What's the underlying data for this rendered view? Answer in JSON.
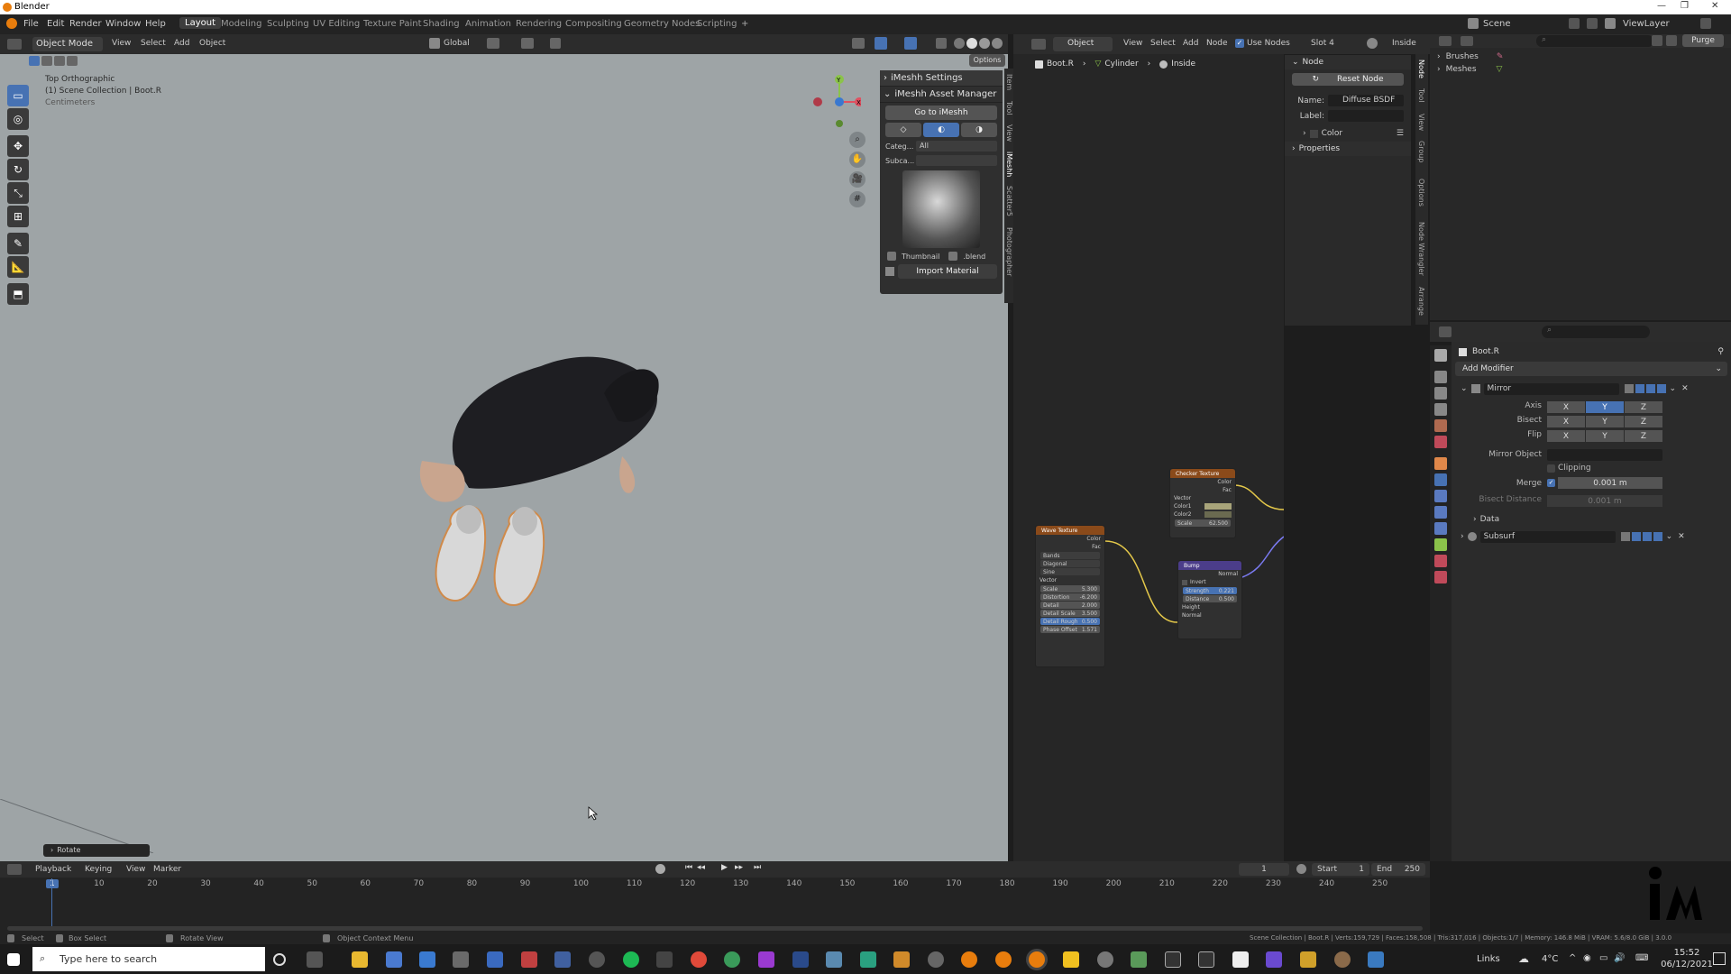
{
  "titlebar": {
    "title": "Blender"
  },
  "menu": [
    "File",
    "Edit",
    "Render",
    "Window",
    "Help"
  ],
  "workspaces": [
    "Layout",
    "Modeling",
    "Sculpting",
    "UV Editing",
    "Texture Paint",
    "Shading",
    "Animation",
    "Rendering",
    "Compositing",
    "Geometry Nodes",
    "Scripting"
  ],
  "scene": {
    "label": "Scene",
    "viewlayer": "ViewLayer",
    "purge": "Purge"
  },
  "viewport_header": {
    "mode": "Object Mode",
    "menus": [
      "View",
      "Select",
      "Add",
      "Object"
    ],
    "orientation": "Global",
    "options": "Options"
  },
  "viewport_info": {
    "line1": "Top Orthographic",
    "line2": "(1) Scene Collection | Boot.R",
    "line3": "Centimeters"
  },
  "npanel": {
    "settings": "iMeshh Settings",
    "asset_manager": "iMeshh Asset Manager",
    "goto": "Go to iMeshh",
    "category_label": "Categ...",
    "category_value": "All",
    "subcategory_label": "Subca...",
    "thumbnail": "Thumbnail",
    "blend": ".blend",
    "import": "Import Material"
  },
  "npanel_tabs": [
    "Item",
    "Tool",
    "View",
    "iMeshh",
    "Scatter5",
    "Photographer"
  ],
  "last_op": "Rotate",
  "node_header": {
    "object": "Object",
    "menus": [
      "View",
      "Select",
      "Add",
      "Node"
    ],
    "use_nodes": "Use Nodes",
    "slot": "Slot 4",
    "inside": "Inside"
  },
  "node_breadcrumb": [
    "Boot.R",
    "Cylinder",
    "Inside"
  ],
  "node_panel": {
    "title": "Node",
    "reset": "Reset Node",
    "name_label": "Name:",
    "name_value": "Diffuse BSDF",
    "label_label": "Label:",
    "color": "Color",
    "properties": "Properties"
  },
  "node_tabs": [
    "Node",
    "Tool",
    "View",
    "Group",
    "Options",
    "Node Wrangler",
    "Arrange"
  ],
  "nodes": {
    "checker": {
      "title": "Checker Texture",
      "outputs": [
        "Color",
        "Fac"
      ],
      "inputs": [
        "Vector",
        "Color1",
        "Color2"
      ],
      "scale": "Scale",
      "scale_val": "62.500"
    },
    "wave": {
      "title": "Wave Texture",
      "outputs": [
        "Color",
        "Fac"
      ],
      "dropdowns": [
        "Bands",
        "Diagonal",
        "Sine"
      ],
      "vector": "Vector",
      "fields": [
        [
          "Scale",
          "5.300"
        ],
        [
          "Distortion",
          "-6.200"
        ],
        [
          "Detail",
          "2.000"
        ],
        [
          "Detail Scale",
          "3.500"
        ],
        [
          "Detail Rough",
          "0.500"
        ],
        [
          "Phase Offset",
          "1.571"
        ]
      ]
    },
    "bump": {
      "title": "Bump",
      "output": "Normal",
      "invert": "Invert",
      "fields": [
        [
          "Strength",
          "0.221"
        ],
        [
          "Distance",
          "0.500"
        ]
      ],
      "inputs": [
        "Height",
        "Normal"
      ]
    }
  },
  "outliner": {
    "items": [
      "Brushes",
      "Meshes"
    ]
  },
  "properties": {
    "object": "Boot.R",
    "add_modifier": "Add Modifier",
    "mirror": "Mirror",
    "axis": "Axis",
    "bisect": "Bisect",
    "flip": "Flip",
    "xyz": [
      "X",
      "Y",
      "Z"
    ],
    "mirror_object": "Mirror Object",
    "clipping": "Clipping",
    "merge": "Merge",
    "merge_val": "0.001 m",
    "bisect_distance": "Bisect Distance",
    "bisect_val": "0.001 m",
    "data": "Data",
    "subsurf": "Subsurf"
  },
  "timeline": {
    "menus": [
      "Playback",
      "Keying",
      "View",
      "Marker"
    ],
    "current": "1",
    "start_label": "Start",
    "start": "1",
    "end_label": "End",
    "end": "250",
    "ticks": [
      "1",
      "10",
      "20",
      "30",
      "40",
      "50",
      "60",
      "70",
      "80",
      "90",
      "100",
      "110",
      "120",
      "130",
      "140",
      "150",
      "160",
      "170",
      "180",
      "190",
      "200",
      "210",
      "220",
      "230",
      "240",
      "250"
    ]
  },
  "statusbar": {
    "select": "Select",
    "box_select": "Box Select",
    "rotate_view": "Rotate View",
    "context": "Object Context Menu",
    "stats": "Scene Collection | Boot.R | Verts:159,729 | Faces:158,508 | Tris:317,016 | Objects:1/7 | Memory: 146.8 MiB | VRAM: 5.6/8.0 GiB | 3.0.0"
  },
  "taskbar": {
    "search": "Type here to search",
    "links": "Links",
    "weather": "4°C",
    "time": "15:52",
    "date": "06/12/2021"
  },
  "colors": {
    "accent": "#4772b3",
    "viewport_bg": "#9ea4a6"
  }
}
